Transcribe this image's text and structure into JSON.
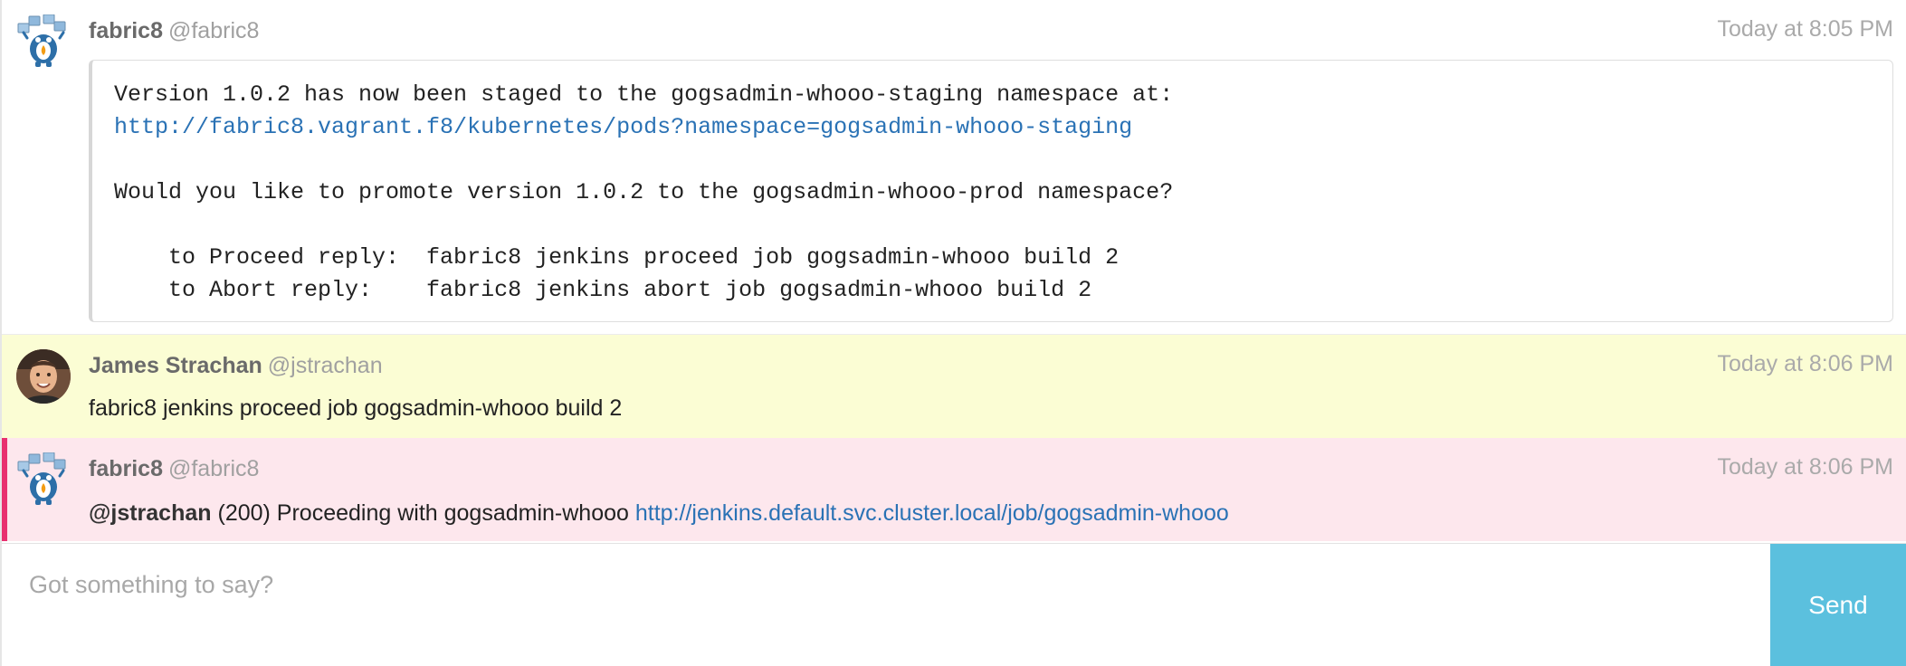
{
  "messages": [
    {
      "author": "fabric8",
      "handle": "@fabric8",
      "time": "Today at 8:05 PM",
      "avatar_icon": "fabric8-mascot-icon",
      "code_lines": {
        "l1": "Version 1.0.2 has now been staged to the gogsadmin-whooo-staging namespace at:",
        "l2_link": "http://fabric8.vagrant.f8/kubernetes/pods?namespace=gogsadmin-whooo-staging",
        "l3": "",
        "l4": "Would you like to promote version 1.0.2 to the gogsadmin-whooo-prod namespace?",
        "l5": "",
        "l6": "    to Proceed reply:  fabric8 jenkins proceed job gogsadmin-whooo build 2",
        "l7": "    to Abort reply:    fabric8 jenkins abort job gogsadmin-whooo build 2"
      }
    },
    {
      "author": "James Strachan",
      "handle": "@jstrachan",
      "time": "Today at 8:06 PM",
      "avatar_icon": "user-photo-avatar",
      "text": "fabric8 jenkins proceed job gogsadmin-whooo build 2"
    },
    {
      "author": "fabric8",
      "handle": "@fabric8",
      "time": "Today at 8:06 PM",
      "avatar_icon": "fabric8-mascot-icon",
      "mention": "@jstrachan",
      "text": " (200) Proceeding with gogsadmin-whooo ",
      "link": "http://jenkins.default.svc.cluster.local/job/gogsadmin-whooo"
    }
  ],
  "composer": {
    "placeholder": "Got something to say?",
    "send_label": "Send"
  },
  "colors": {
    "highlight_mention_bg": "#fde7ed",
    "highlight_mention_bar": "#e8306f",
    "own_message_bg": "#fbfdd4",
    "link": "#2a72b5",
    "send_button": "#5bc0de"
  }
}
